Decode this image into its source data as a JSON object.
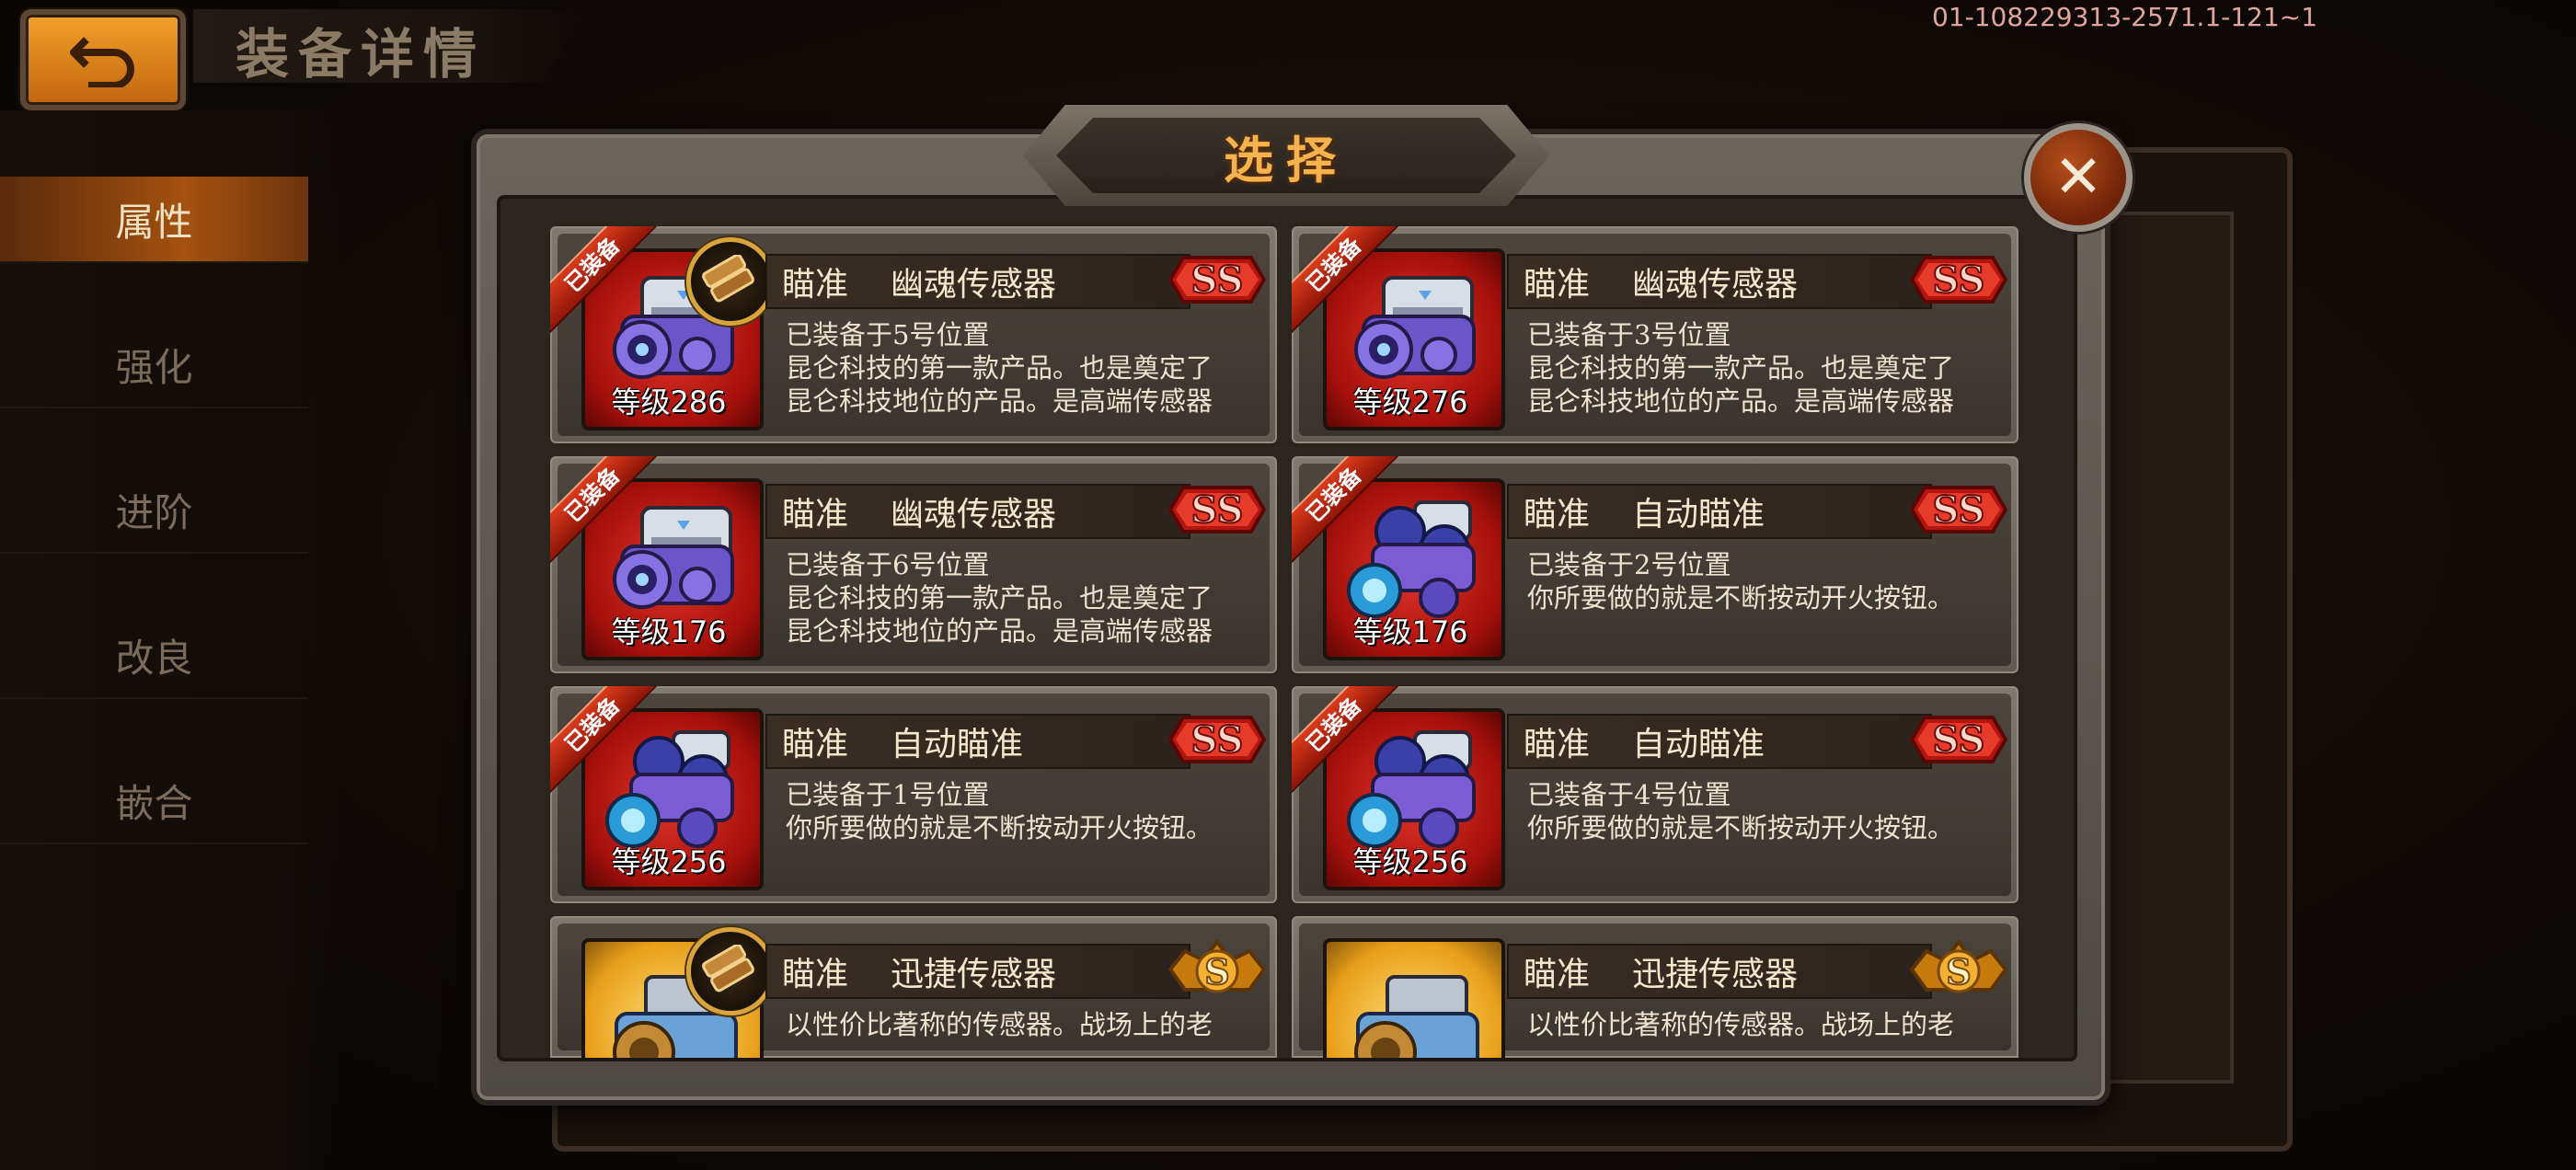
{
  "header": {
    "title": "装备详情",
    "debug_id": "01-108229313-2571.1-121~1"
  },
  "sidebar": {
    "items": [
      {
        "label": "属性",
        "active": true
      },
      {
        "label": "强化",
        "active": false
      },
      {
        "label": "进阶",
        "active": false
      },
      {
        "label": "改良",
        "active": false
      },
      {
        "label": "嵌合",
        "active": false
      }
    ]
  },
  "dialog": {
    "title": "选择",
    "close_icon": "close-x"
  },
  "cards": [
    {
      "category": "瞄准",
      "name": "幽魂传感器",
      "equipped_tag": "已装备",
      "grade": "SS",
      "level": "等级286",
      "line1": "已装备于5号位置",
      "line2": "昆仑科技的第一款产品。也是奠定了",
      "line3": "昆仑科技地位的产品。是高端传感器"
    },
    {
      "category": "瞄准",
      "name": "幽魂传感器",
      "equipped_tag": "已装备",
      "grade": "SS",
      "level": "等级276",
      "line1": "已装备于3号位置",
      "line2": "昆仑科技的第一款产品。也是奠定了",
      "line3": "昆仑科技地位的产品。是高端传感器"
    },
    {
      "category": "瞄准",
      "name": "幽魂传感器",
      "equipped_tag": "已装备",
      "grade": "SS",
      "level": "等级176",
      "line1": "已装备于6号位置",
      "line2": "昆仑科技的第一款产品。也是奠定了",
      "line3": "昆仑科技地位的产品。是高端传感器"
    },
    {
      "category": "瞄准",
      "name": "自动瞄准",
      "equipped_tag": "已装备",
      "grade": "SS",
      "level": "等级176",
      "line1": "已装备于2号位置",
      "line2": "你所要做的就是不断按动开火按钮。",
      "line3": ""
    },
    {
      "category": "瞄准",
      "name": "自动瞄准",
      "equipped_tag": "已装备",
      "grade": "SS",
      "level": "等级256",
      "line1": "已装备于1号位置",
      "line2": "你所要做的就是不断按动开火按钮。",
      "line3": ""
    },
    {
      "category": "瞄准",
      "name": "自动瞄准",
      "equipped_tag": "已装备",
      "grade": "SS",
      "level": "等级256",
      "line1": "已装备于4号位置",
      "line2": "你所要做的就是不断按动开火按钮。",
      "line3": ""
    },
    {
      "category": "瞄准",
      "name": "迅捷传感器",
      "equipped_tag": "",
      "grade": "S",
      "level": "",
      "line1": "以性价比著称的传感器。战场上的老",
      "line2": "",
      "line3": ""
    },
    {
      "category": "瞄准",
      "name": "迅捷传感器",
      "equipped_tag": "",
      "grade": "S",
      "level": "",
      "line1": "以性价比著称的传感器。战场上的老",
      "line2": "",
      "line3": ""
    }
  ],
  "colors": {
    "accent_orange": "#f4b34c",
    "active_tab": "#a4520f",
    "grade_ss": "#d6201a",
    "grade_s": "#f0a21c"
  }
}
